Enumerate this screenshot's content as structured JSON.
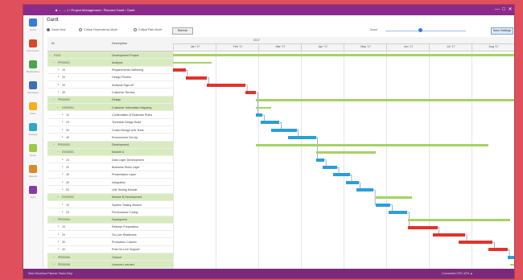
{
  "window": {
    "crumbs": "■  ←  →  ⌂  /  Project Management  /  Planned Gantt  /  Gantt",
    "controls": [
      "—",
      "□",
      "✕"
    ]
  },
  "page": {
    "title": "Gantt"
  },
  "toolbar": {
    "options": [
      {
        "label": "Gantt View",
        "selected": true
      },
      {
        "label": "Critical Dependency Mode",
        "selected": false
      },
      {
        "label": "Critical Path Mode",
        "selected": false
      }
    ],
    "refresh_label": "Refresh",
    "zoom_label": "Zoom",
    "zoom_value": 0.43,
    "save_label": "Save Settings"
  },
  "sidebar": {
    "items": [
      {
        "label": "Home",
        "icon": "home-icon",
        "color": "#3a7bd5"
      },
      {
        "label": "Documents",
        "icon": "document-icon",
        "color": "#d9482b"
      },
      {
        "label": "Marketplace",
        "icon": "store-icon",
        "color": "#4aa64a"
      },
      {
        "label": "Messages",
        "icon": "message-icon",
        "color": "#3d6fb8"
      },
      {
        "label": "Ideas",
        "icon": "lightbulb-icon",
        "color": "#f2b01e"
      },
      {
        "label": "Settings",
        "icon": "gear-icon",
        "color": "#2fa7c9"
      },
      {
        "label": "Notes",
        "icon": "note-icon",
        "color": "#9dc94a"
      },
      {
        "label": "Reports",
        "icon": "chart-icon",
        "color": "#d98a2b"
      },
      {
        "label": "Apps",
        "icon": "apps-icon",
        "color": "#8a3aa8"
      }
    ]
  },
  "grid": {
    "headers": {
      "id": "ID",
      "name": "Description"
    },
    "year_label": "2017",
    "months": [
      "Jan '17",
      "Feb '17",
      "Mar '17",
      "Apr '17",
      "May '17",
      "Jun '17",
      "Jul '17",
      "Aug '17"
    ],
    "rows": [
      {
        "id": "P100",
        "name": "Development Project",
        "level": 0,
        "summary": true
      },
      {
        "id": "PR00001",
        "name": "Analysis",
        "level": 1,
        "summary": true
      },
      {
        "id": "10",
        "name": "Requirements Gathering",
        "level": 2,
        "summary": false
      },
      {
        "id": "20",
        "name": "Design Review",
        "level": 2,
        "summary": false
      },
      {
        "id": "30",
        "name": "Analysis Sign-off",
        "level": 2,
        "summary": false
      },
      {
        "id": "40",
        "name": "Customer Review",
        "level": 2,
        "summary": false
      },
      {
        "id": "PR00002",
        "name": "Design",
        "level": 1,
        "summary": true
      },
      {
        "id": "DS00001",
        "name": "Customer Information Mapping",
        "level": 2,
        "summary": true
      },
      {
        "id": "10",
        "name": "Confirmation of Business Rules",
        "level": 3,
        "summary": false
      },
      {
        "id": "20",
        "name": "Technical Design Build",
        "level": 3,
        "summary": false
      },
      {
        "id": "30",
        "name": "Coded Design Unit Tests",
        "level": 3,
        "summary": false
      },
      {
        "id": "40",
        "name": "Environment Set-Up",
        "level": 3,
        "summary": false
      },
      {
        "id": "PR00003",
        "name": "Development",
        "level": 1,
        "summary": true
      },
      {
        "id": "DV00001",
        "name": "Module A",
        "level": 2,
        "summary": true
      },
      {
        "id": "10",
        "name": "Data Layer Development",
        "level": 3,
        "summary": false
      },
      {
        "id": "20",
        "name": "Business Rules Layer",
        "level": 3,
        "summary": false
      },
      {
        "id": "30",
        "name": "Presentation Layer",
        "level": 3,
        "summary": false
      },
      {
        "id": "40",
        "name": "Integration",
        "level": 3,
        "summary": false
      },
      {
        "id": "50",
        "name": "Unit Testing Module",
        "level": 3,
        "summary": false
      },
      {
        "id": "DV00002",
        "name": "Module B Development",
        "level": 2,
        "summary": true
      },
      {
        "id": "10",
        "name": "System Testing Module",
        "level": 3,
        "summary": false
      },
      {
        "id": "20",
        "name": "Performance Tuning",
        "level": 3,
        "summary": false
      },
      {
        "id": "PR00004",
        "name": "Deployment",
        "level": 1,
        "summary": true
      },
      {
        "id": "10",
        "name": "Release Preparation",
        "level": 2,
        "summary": false
      },
      {
        "id": "20",
        "name": "Go-Live Readiness",
        "level": 2,
        "summary": false
      },
      {
        "id": "30",
        "name": "Production Cutover",
        "level": 2,
        "summary": false
      },
      {
        "id": "40",
        "name": "Post-Go-Live Support",
        "level": 2,
        "summary": false
      },
      {
        "id": "PR00005",
        "name": "Closure",
        "level": 1,
        "summary": true
      },
      {
        "id": "PR00006",
        "name": "Lessons Learned",
        "level": 1,
        "summary": true
      }
    ],
    "bars": [
      {
        "row": 0,
        "start": 0,
        "end": 8,
        "color": "green"
      },
      {
        "row": 1,
        "start": 0,
        "end": 0.9,
        "color": "green"
      },
      {
        "row": 2,
        "start": 0,
        "end": 0.3,
        "color": "red"
      },
      {
        "row": 3,
        "start": 0.3,
        "end": 0.8,
        "color": "red"
      },
      {
        "row": 4,
        "start": 0.8,
        "end": 1.7,
        "color": "red"
      },
      {
        "row": 5,
        "start": 1.7,
        "end": 1.95,
        "color": "red"
      },
      {
        "row": 6,
        "start": 1.95,
        "end": 8,
        "color": "green"
      },
      {
        "row": 7,
        "start": 1.95,
        "end": 2.3,
        "color": "green"
      },
      {
        "row": 8,
        "start": 1.95,
        "end": 2.1,
        "color": "blue"
      },
      {
        "row": 9,
        "start": 2.05,
        "end": 2.5,
        "color": "blue"
      },
      {
        "row": 10,
        "start": 2.3,
        "end": 2.9,
        "color": "blue"
      },
      {
        "row": 11,
        "start": 2.7,
        "end": 3.35,
        "color": "blue"
      },
      {
        "row": 12,
        "start": 1.95,
        "end": 7.4,
        "color": "green"
      },
      {
        "row": 13,
        "start": 3.35,
        "end": 4.75,
        "color": "green"
      },
      {
        "row": 14,
        "start": 3.35,
        "end": 3.55,
        "color": "blue"
      },
      {
        "row": 15,
        "start": 3.5,
        "end": 3.85,
        "color": "blue"
      },
      {
        "row": 16,
        "start": 3.75,
        "end": 4.15,
        "color": "blue"
      },
      {
        "row": 17,
        "start": 4.05,
        "end": 4.35,
        "color": "blue"
      },
      {
        "row": 18,
        "start": 4.3,
        "end": 4.7,
        "color": "blue"
      },
      {
        "row": 19,
        "start": 4.75,
        "end": 5.6,
        "color": "green"
      },
      {
        "row": 20,
        "start": 4.75,
        "end": 5.1,
        "color": "blue"
      },
      {
        "row": 21,
        "start": 5.05,
        "end": 5.5,
        "color": "blue"
      },
      {
        "row": 22,
        "start": 5.5,
        "end": 7.9,
        "color": "green"
      },
      {
        "row": 23,
        "start": 5.5,
        "end": 6.2,
        "color": "red"
      },
      {
        "row": 24,
        "start": 6.1,
        "end": 6.85,
        "color": "red"
      },
      {
        "row": 25,
        "start": 6.7,
        "end": 7.5,
        "color": "red"
      },
      {
        "row": 26,
        "start": 7.4,
        "end": 7.85,
        "color": "red"
      },
      {
        "row": 27,
        "start": 7.85,
        "end": 8,
        "color": "blue"
      },
      {
        "row": 28,
        "start": 7.9,
        "end": 8,
        "color": "green"
      }
    ]
  },
  "status": {
    "left": "Start   Workflow   Planner   Tasks   Help",
    "right": "Connected   CPU   42%   ▲"
  }
}
